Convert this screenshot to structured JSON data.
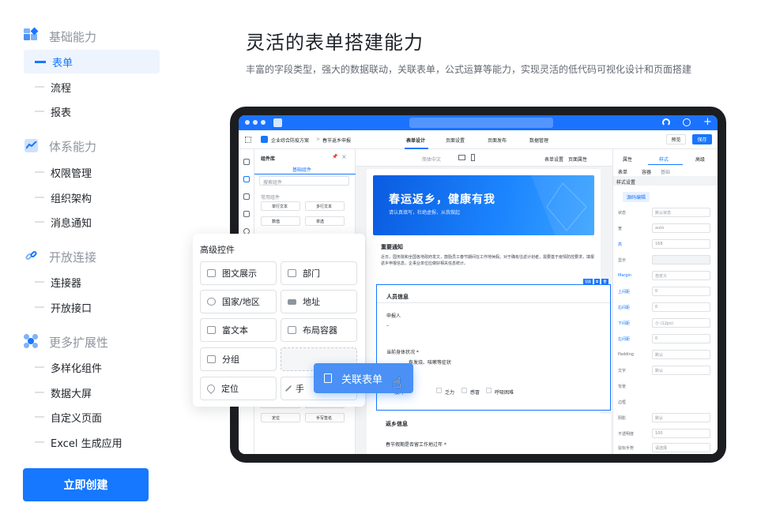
{
  "nav": {
    "groups": [
      {
        "label": "基础能力",
        "icon": "blocks-icon",
        "items": [
          "表单",
          "流程",
          "报表"
        ]
      },
      {
        "label": "体系能力",
        "icon": "chart-line-icon",
        "items": [
          "权限管理",
          "组织架构",
          "消息通知"
        ]
      },
      {
        "label": "开放连接",
        "icon": "link-icon",
        "items": [
          "连接器",
          "开放接口"
        ]
      },
      {
        "label": "更多扩展性",
        "icon": "expand-icon",
        "items": [
          "多样化组件",
          "数据大屏",
          "自定义页面",
          "Excel 生成应用"
        ]
      }
    ],
    "active_item": "表单",
    "create_button": "立即创建"
  },
  "hero": {
    "title": "灵活的表单搭建能力",
    "subtitle": "丰富的字段类型，强大的数据联动，关联表单，公式运算等能力，实现灵活的低代码可视化设计和页面搭建"
  },
  "app": {
    "breadcrumb": [
      "企业综合防疫方案",
      "春节返乡申报"
    ],
    "tabs": [
      "表单设计",
      "页面设置",
      "页面发布",
      "数据管理"
    ],
    "preview": "预览",
    "save": "保存",
    "library": {
      "title": "组件库",
      "tab": "基础组件",
      "search_placeholder": "搜索组件",
      "section": "常用组件",
      "items": [
        "单行文本",
        "多行文本",
        "数值",
        "单选"
      ],
      "bottom_items": [
        "分组",
        "关联表单",
        "定位",
        "手写签名"
      ]
    },
    "canvas_toolbar": [
      "简体中文",
      "表单设置",
      "页面属性"
    ],
    "banner_title": "春运返乡，健康有我",
    "banner_subtitle": "请认真填写，杜绝虚报，从我做起",
    "notice_title": "重要通知",
    "notice_body": "近日，国务院和全国各地政府发文，鼓励员工春节期间在工作地休假。对于确有往返计划者，需要基于疫情防控要求，填报返乡申报信息，企事业单位应做好相关信息统计。",
    "selected_tags": [
      "容器",
      "⧉",
      "🗑"
    ],
    "person_section": "人员信息",
    "applicant_label": "申报人",
    "applicant_value": "–",
    "health_label": "当前身体状况 *",
    "health_options": [
      "健康",
      "有发烧、咳嗽等症状"
    ],
    "symptoms": [
      "腹泻",
      "乏力",
      "感冒",
      "呼吸困难"
    ],
    "return_section": "返乡信息",
    "return_question": "春节假期是否留工作地过年 *",
    "props": {
      "tabs": [
        "属性",
        "样式",
        "高级"
      ],
      "path": [
        "表单",
        "容器",
        "基础"
      ],
      "group": "样式设置",
      "source_code": "源码编辑",
      "rows": [
        {
          "label": "状态",
          "value": "默认状态"
        },
        {
          "label": "宽",
          "value": "auto"
        },
        {
          "label": "高",
          "value": "168"
        },
        {
          "label": "显示",
          "value": ""
        },
        {
          "label": "Margin",
          "value": "自定义"
        },
        {
          "label": "上间距",
          "value": "0"
        },
        {
          "label": "右间距",
          "value": "0"
        },
        {
          "label": "下间距",
          "value": "小 (12px)"
        },
        {
          "label": "左间距",
          "value": "0"
        },
        {
          "label": "Padding",
          "value": "默认"
        },
        {
          "label": "文字",
          "value": "默认"
        },
        {
          "label": "背景",
          "value": ""
        },
        {
          "label": "边框",
          "value": ""
        },
        {
          "label": "阴影",
          "value": "默认"
        },
        {
          "label": "不透明度",
          "value": "100"
        },
        {
          "label": "鼠标手势",
          "value": "请选择"
        }
      ]
    }
  },
  "panel": {
    "title": "高级控件",
    "items": [
      {
        "label": "图文展示",
        "icon": "image-text-icon"
      },
      {
        "label": "部门",
        "icon": "department-icon"
      },
      {
        "label": "国家/地区",
        "icon": "globe-icon"
      },
      {
        "label": "地址",
        "icon": "map-icon"
      },
      {
        "label": "富文本",
        "icon": "rich-text-icon"
      },
      {
        "label": "布局容器",
        "icon": "layout-icon"
      },
      {
        "label": "分组",
        "icon": "group-icon"
      },
      {
        "label": "",
        "icon": ""
      },
      {
        "label": "定位",
        "icon": "location-icon"
      },
      {
        "label": "手",
        "icon": "pen-icon"
      }
    ],
    "dragging": "关联表单"
  },
  "colors": {
    "brand": "#1677ff",
    "text": "#1f2329",
    "muted": "#8f959e"
  }
}
